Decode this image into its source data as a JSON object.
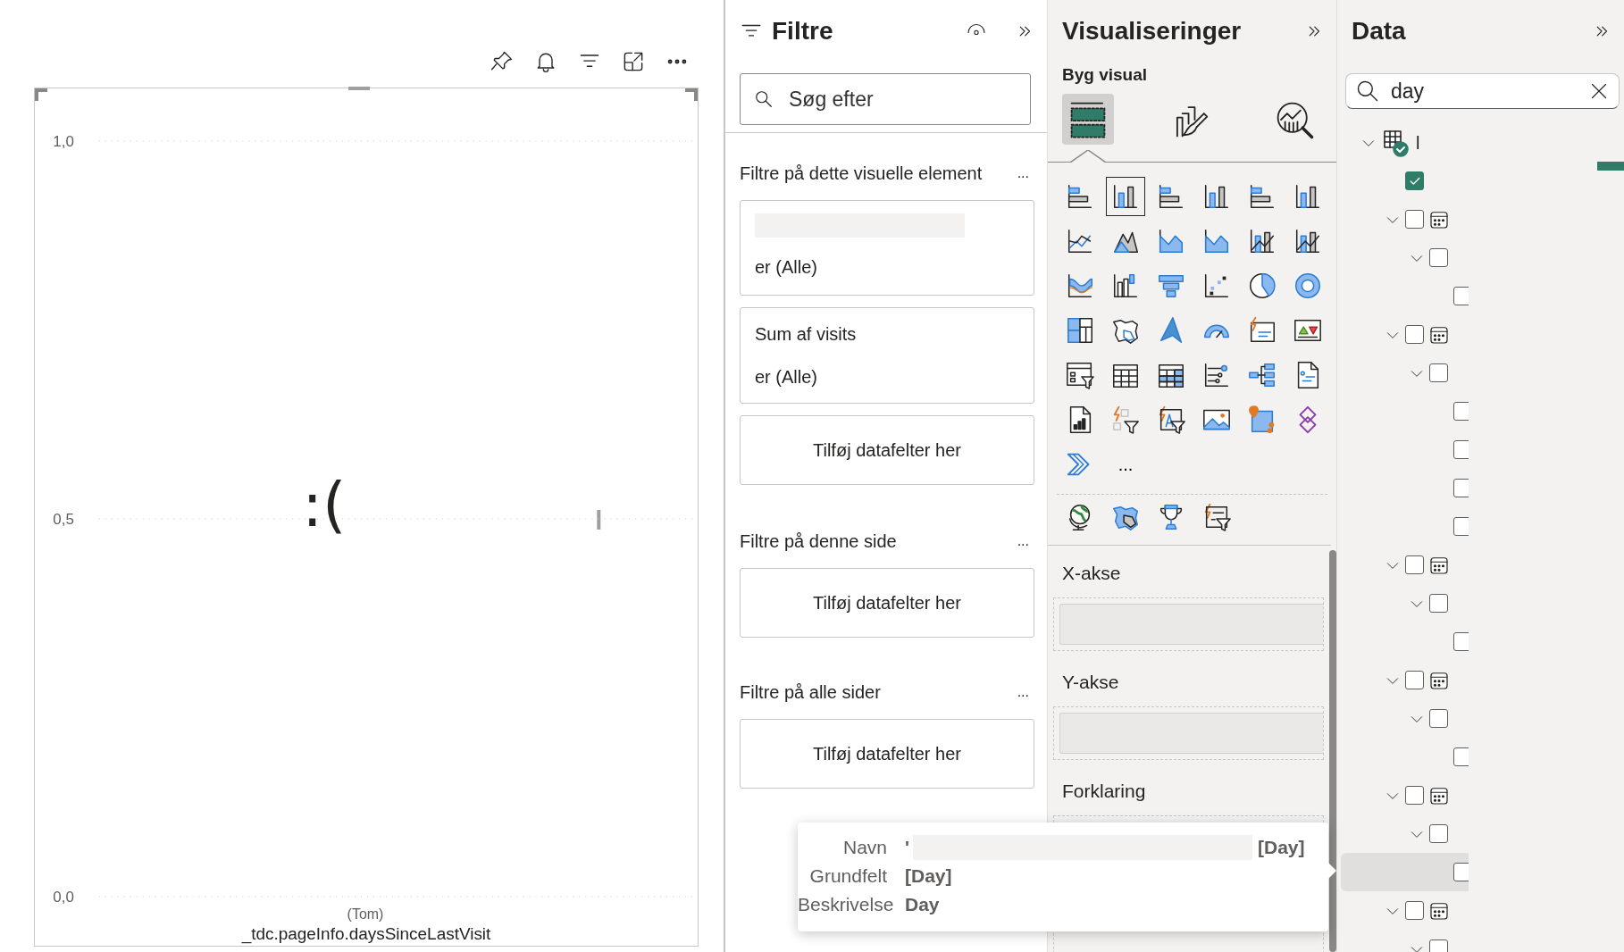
{
  "visual": {
    "empty_message": ":(",
    "chart_data": {
      "type": "bar",
      "xlabel": "_tdc.pageInfo.daysSinceLastVisit",
      "categories": [
        "(Tom)"
      ],
      "values": [
        null
      ],
      "ylim": [
        0,
        1
      ],
      "yticks": [
        {
          "value": 1,
          "label": "1,0"
        },
        {
          "value": 0.5,
          "label": "0,5"
        },
        {
          "value": 0,
          "label": "0,0"
        }
      ]
    }
  },
  "filters_pane": {
    "title": "Filtre",
    "search": {
      "placeholder": "Søg efter"
    },
    "sections": [
      {
        "title": "Filtre på dette visuelle element",
        "more": "...",
        "cards": [
          {
            "kind": "filter",
            "condition": "er (Alle)"
          },
          {
            "kind": "filter",
            "field": "Sum af visits",
            "condition": "er (Alle)"
          },
          {
            "kind": "drop",
            "label": "Tilføj datafelter her"
          }
        ]
      },
      {
        "title": "Filtre på denne side",
        "more": "...",
        "cards": [
          {
            "kind": "drop",
            "label": "Tilføj datafelter her"
          }
        ]
      },
      {
        "title": "Filtre på alle sider",
        "more": "...",
        "cards": [
          {
            "kind": "drop",
            "label": "Tilføj datafelter her"
          }
        ]
      }
    ]
  },
  "viz_pane": {
    "title": "Visualiseringer",
    "subtitle": "Byg visual",
    "modes": [
      {
        "selected": true
      },
      {
        "selected": false
      },
      {
        "selected": false
      }
    ],
    "gallery": [
      {
        "selected": false
      },
      {
        "selected": true
      },
      {
        "selected": false
      },
      {
        "selected": false
      },
      {
        "selected": false
      },
      {
        "selected": false
      },
      {
        "selected": false
      },
      {
        "selected": false
      },
      {
        "selected": false
      },
      {
        "selected": false
      },
      {
        "selected": false
      },
      {
        "selected": false
      },
      {
        "selected": false
      },
      {
        "selected": false
      },
      {
        "selected": false
      },
      {
        "selected": false
      },
      {
        "selected": false
      },
      {
        "selected": false
      },
      {
        "selected": false
      },
      {
        "selected": false
      },
      {
        "selected": false
      },
      {
        "selected": false
      },
      {
        "selected": false
      },
      {
        "selected": false
      },
      {
        "selected": false
      },
      {
        "selected": false
      },
      {
        "selected": false
      },
      {
        "selected": false
      },
      {
        "selected": false
      },
      {
        "selected": false
      },
      {
        "selected": false
      },
      {
        "selected": false
      },
      {
        "selected": false
      },
      {
        "selected": false
      },
      {
        "selected": false
      },
      {
        "selected": false
      },
      {
        "selected": false
      }
    ],
    "more": "...",
    "custom_visuals": [
      {
        "selected": false
      },
      {
        "selected": false
      },
      {
        "selected": false
      },
      {
        "selected": false
      }
    ],
    "wells": [
      {
        "title": "X-akse",
        "kind": "field"
      },
      {
        "title": "Y-akse",
        "kind": "field"
      },
      {
        "title": "Forklaring",
        "kind": "empty"
      }
    ]
  },
  "data_pane": {
    "title": "Data",
    "search": {
      "value": "day"
    },
    "tree": {
      "kind": "table",
      "name": "l",
      "expanded": true,
      "children": [
        {
          "kind": "measure",
          "checked": true
        },
        {
          "kind": "date_table",
          "checked": false,
          "expanded": true,
          "children": [
            {
              "checked": false,
              "expanded": true,
              "children": [
                {
                  "checked": false,
                  "highlighted": false
                }
              ]
            }
          ]
        },
        {
          "kind": "date_table",
          "checked": false,
          "expanded": true,
          "children": [
            {
              "checked": false,
              "expanded": true,
              "children": [
                {
                  "checked": false,
                  "highlighted": false
                },
                {
                  "checked": false,
                  "highlighted": false
                },
                {
                  "checked": false,
                  "highlighted": false
                },
                {
                  "checked": false,
                  "highlighted": false
                }
              ]
            }
          ]
        },
        {
          "kind": "date_table",
          "checked": false,
          "expanded": true,
          "children": [
            {
              "checked": false,
              "expanded": true,
              "children": [
                {
                  "checked": false,
                  "highlighted": false
                }
              ]
            }
          ]
        },
        {
          "kind": "date_table",
          "checked": false,
          "expanded": true,
          "children": [
            {
              "checked": false,
              "expanded": true,
              "children": [
                {
                  "checked": false,
                  "highlighted": false
                }
              ]
            }
          ]
        },
        {
          "kind": "date_table",
          "checked": false,
          "expanded": true,
          "children": [
            {
              "checked": false,
              "expanded": true,
              "children": [
                {
                  "checked": false,
                  "highlighted": true
                }
              ]
            }
          ]
        },
        {
          "kind": "date_table",
          "checked": false,
          "expanded": true,
          "children": [
            {
              "checked": false,
              "expanded": true
            }
          ]
        }
      ]
    }
  },
  "tooltip": {
    "rows": [
      {
        "label": "Navn",
        "value_start": "'",
        "value_end": "[Day]"
      },
      {
        "label": "Grundfelt",
        "value": "[Day]"
      },
      {
        "label": "Beskrivelse",
        "value": "Day"
      }
    ]
  }
}
